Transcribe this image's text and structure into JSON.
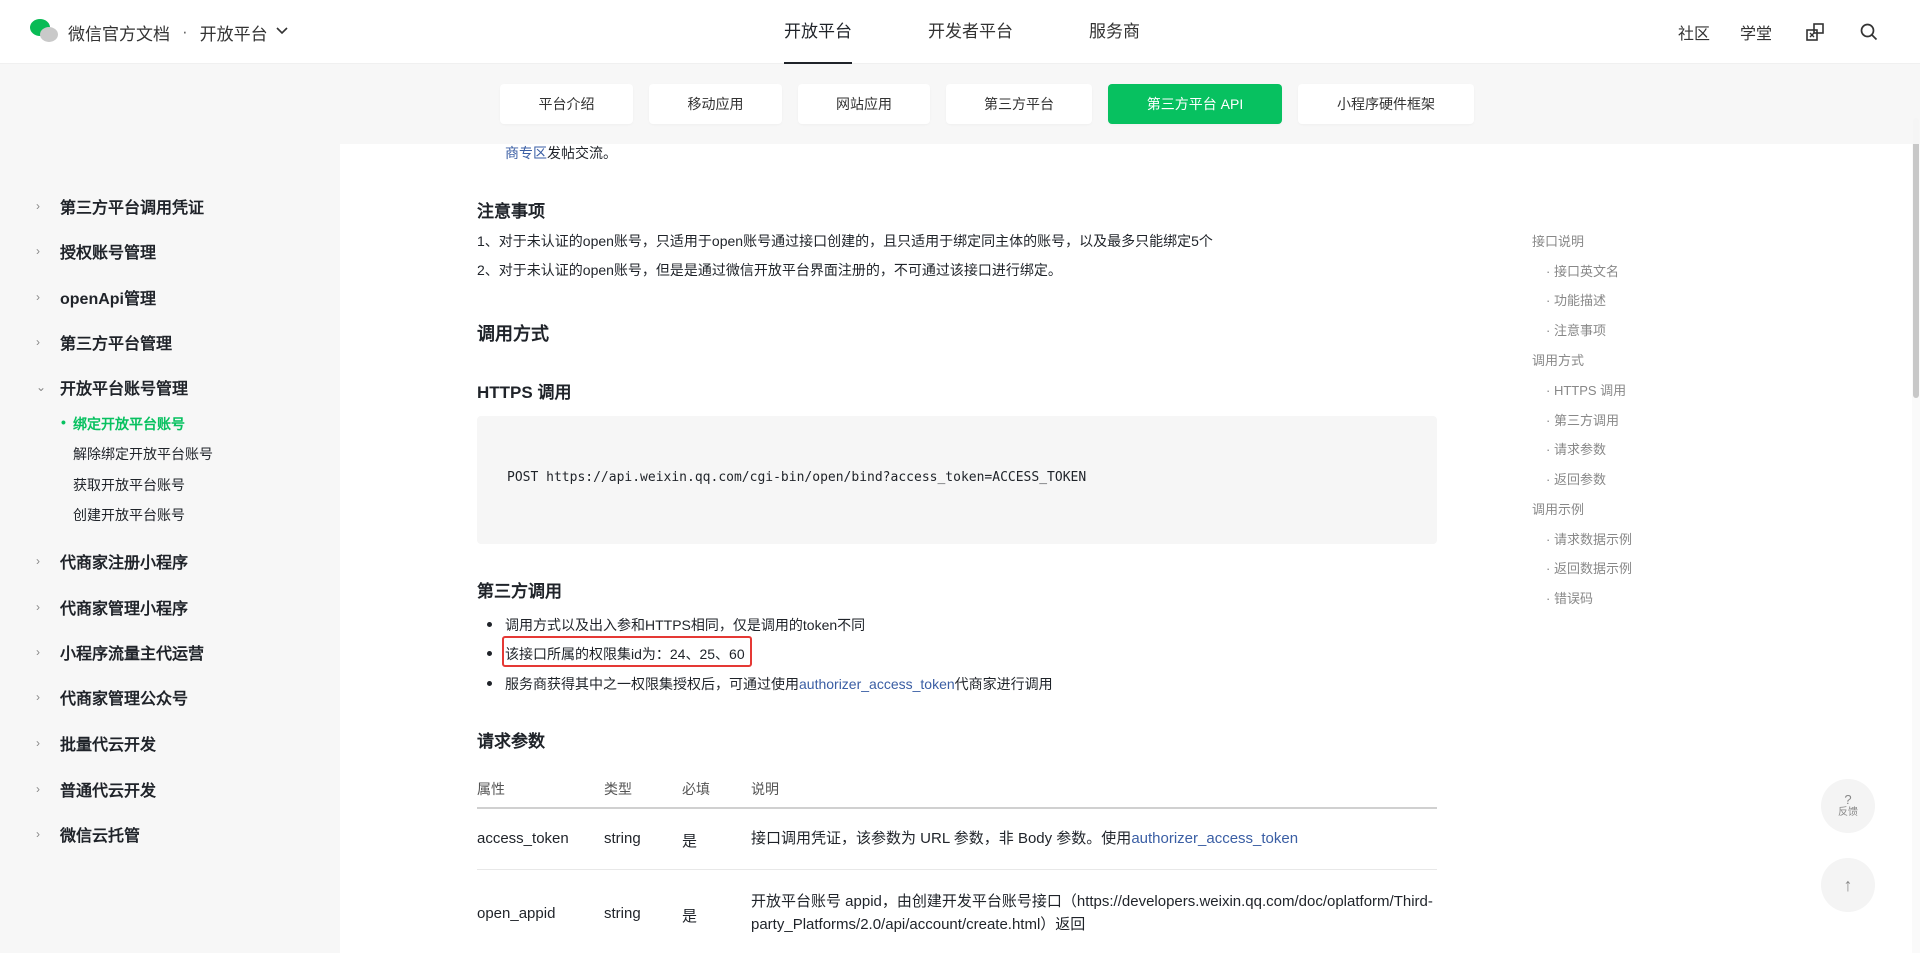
{
  "header": {
    "brand": "微信官方文档",
    "separator": "·",
    "platform": "开放平台",
    "nav": [
      "开放平台",
      "开发者平台",
      "服务商"
    ],
    "right_links": [
      "社区",
      "学堂"
    ],
    "icons": [
      "cube-swap-icon",
      "search-icon"
    ]
  },
  "subtabs": [
    "平台介绍",
    "移动应用",
    "网站应用",
    "第三方平台",
    "第三方平台 API",
    "小程序硬件框架"
  ],
  "sidebar": {
    "items": [
      "第三方平台调用凭证",
      "授权账号管理",
      "openApi管理",
      "第三方平台管理",
      "开放平台账号管理",
      "代商家注册小程序",
      "代商家管理小程序",
      "小程序流量主代运营",
      "代商家管理公众号",
      "批量代云开发",
      "普通代云开发",
      "微信云托管"
    ],
    "subitems": [
      "绑定开放平台账号",
      "解除绑定开放平台账号",
      "获取开放平台账号",
      "创建开放平台账号"
    ]
  },
  "content": {
    "partial_line_a": "商专区",
    "partial_line_b": "发帖交流。",
    "notes_title": "注意事项",
    "note1": "1、对于未认证的open账号，只适用于open账号通过接口创建的，且只适用于绑定同主体的账号，以及最多只能绑定5个",
    "note2": "2、对于未认证的open账号，但是是通过微信开放平台界面注册的，不可通过该接口进行绑定。",
    "call_title": "调用方式",
    "https_title": "HTTPS 调用",
    "code": "POST https://api.weixin.qq.com/cgi-bin/open/bind?access_token=ACCESS_TOKEN",
    "third_title": "第三方调用",
    "bullet1": "调用方式以及出入参和HTTPS相同，仅是调用的token不同",
    "bullet2": "该接口所属的权限集id为：24、25、60",
    "bullet3_pre": "服务商获得其中之一权限集授权后，可通过使用",
    "bullet3_link": "authorizer_access_token",
    "bullet3_post": "代商家进行调用",
    "params_title": "请求参数",
    "table": {
      "headers": [
        "属性",
        "类型",
        "必填",
        "说明"
      ],
      "rows": [
        {
          "name": "access_token",
          "type": "string",
          "required": "是",
          "desc_pre": "接口调用凭证，该参数为 URL 参数，非 Body 参数。使用",
          "desc_link": "authorizer_access_token"
        },
        {
          "name": "open_appid",
          "type": "string",
          "required": "是",
          "desc_line1": "开放平台账号 appid，由创建开发平台账号接口（https://developers.weixin.qq.com/doc/oplatform/Third-",
          "desc_line2": "party_Platforms/2.0/api/account/create.html）返回"
        }
      ]
    }
  },
  "toc": {
    "items": [
      "接口说明",
      "接口英文名",
      "功能描述",
      "注意事项",
      "调用方式",
      "HTTPS 调用",
      "第三方调用",
      "请求参数",
      "返回参数",
      "调用示例",
      "请求数据示例",
      "返回数据示例",
      "错误码"
    ]
  },
  "fab": {
    "feedback_symbol": "?",
    "feedback_label": "反馈",
    "top_symbol": "↑"
  },
  "colors": {
    "accent": "#07c160",
    "link": "#3a5ea4",
    "highlight": "#e53935"
  }
}
